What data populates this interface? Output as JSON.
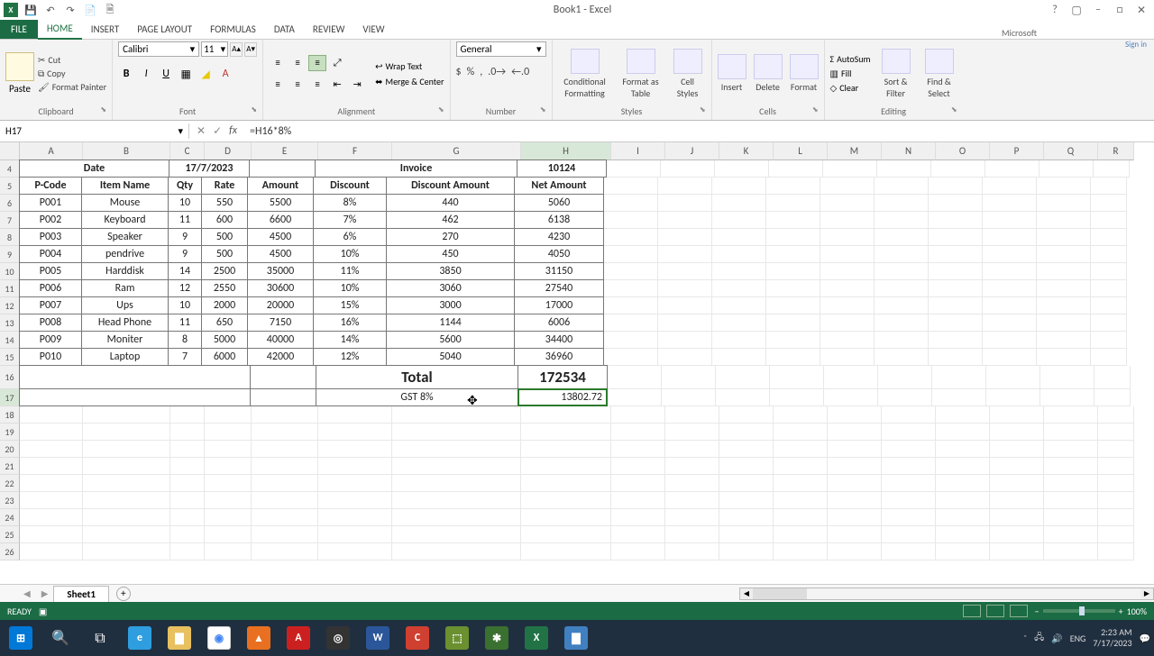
{
  "title": "Book1 - Excel",
  "brand": "Microsoft",
  "qat": {
    "save": "💾",
    "undo": "↶",
    "redo": "↷",
    "new": "📄",
    "doc": "🗎"
  },
  "tabs": [
    "FILE",
    "HOME",
    "INSERT",
    "PAGE LAYOUT",
    "FORMULAS",
    "DATA",
    "REVIEW",
    "VIEW"
  ],
  "ribbon": {
    "clipboard": {
      "name": "Clipboard",
      "paste": "Paste",
      "cut": "Cut",
      "copy": "Copy",
      "fpaint": "Format Painter"
    },
    "font": {
      "name": "Font",
      "family": "Calibri",
      "size": "11"
    },
    "align": {
      "name": "Alignment",
      "wrap": "Wrap Text",
      "merge": "Merge & Center"
    },
    "number": {
      "name": "Number",
      "fmt": "General"
    },
    "styles": {
      "name": "Styles",
      "cf": "Conditional Formatting",
      "fat": "Format as Table",
      "cs": "Cell Styles"
    },
    "cells": {
      "name": "Cells",
      "ins": "Insert",
      "del": "Delete",
      "fmt": "Format"
    },
    "editing": {
      "name": "Editing",
      "autosum": "AutoSum",
      "fill": "Fill",
      "clear": "Clear",
      "sort": "Sort & Filter",
      "find": "Find & Select"
    }
  },
  "signin": "Sign in",
  "namebox": "H17",
  "formula": "=H16*8%",
  "cols": [
    "A",
    "B",
    "C",
    "D",
    "E",
    "F",
    "G",
    "H",
    "I",
    "J",
    "K",
    "L",
    "M",
    "N",
    "O",
    "P",
    "Q",
    "R"
  ],
  "sheet": {
    "r4": {
      "date_lbl": "Date",
      "date_val": "17/7/2023",
      "invoice_lbl": "Invoice",
      "invoice_val": "10124"
    },
    "headers": [
      "P-Code",
      "Item Name",
      "Qty",
      "Rate",
      "Amount",
      "Discount",
      "Discount Amount",
      "Net Amount"
    ],
    "rows": [
      {
        "a": "P001",
        "b": "Mouse",
        "c": "10",
        "d": "550",
        "e": "5500",
        "f": "8%",
        "g": "440",
        "h": "5060"
      },
      {
        "a": "P002",
        "b": "Keyboard",
        "c": "11",
        "d": "600",
        "e": "6600",
        "f": "7%",
        "g": "462",
        "h": "6138"
      },
      {
        "a": "P003",
        "b": "Speaker",
        "c": "9",
        "d": "500",
        "e": "4500",
        "f": "6%",
        "g": "270",
        "h": "4230"
      },
      {
        "a": "P004",
        "b": "pendrive",
        "c": "9",
        "d": "500",
        "e": "4500",
        "f": "10%",
        "g": "450",
        "h": "4050"
      },
      {
        "a": "P005",
        "b": "Harddisk",
        "c": "14",
        "d": "2500",
        "e": "35000",
        "f": "11%",
        "g": "3850",
        "h": "31150"
      },
      {
        "a": "P006",
        "b": "Ram",
        "c": "12",
        "d": "2550",
        "e": "30600",
        "f": "10%",
        "g": "3060",
        "h": "27540"
      },
      {
        "a": "P007",
        "b": "Ups",
        "c": "10",
        "d": "2000",
        "e": "20000",
        "f": "15%",
        "g": "3000",
        "h": "17000"
      },
      {
        "a": "P008",
        "b": "Head Phone",
        "c": "11",
        "d": "650",
        "e": "7150",
        "f": "16%",
        "g": "1144",
        "h": "6006"
      },
      {
        "a": "P009",
        "b": "Moniter",
        "c": "8",
        "d": "5000",
        "e": "40000",
        "f": "14%",
        "g": "5600",
        "h": "34400"
      },
      {
        "a": "P010",
        "b": "Laptop",
        "c": "7",
        "d": "6000",
        "e": "42000",
        "f": "12%",
        "g": "5040",
        "h": "36960"
      }
    ],
    "total_lbl": "Total",
    "total_val": "172534",
    "gst_lbl": "GST 8%",
    "gst_val": "13802.72"
  },
  "sheettab": "Sheet1",
  "status": {
    "ready": "READY",
    "zoom": "100%"
  },
  "taskbar": {
    "time": "2:23 AM",
    "date": "7/17/2023"
  },
  "chart_data": {
    "type": "table",
    "title": "Invoice 10124 — 17/7/2023",
    "columns": [
      "P-Code",
      "Item Name",
      "Qty",
      "Rate",
      "Amount",
      "Discount",
      "Discount Amount",
      "Net Amount"
    ],
    "rows": [
      [
        "P001",
        "Mouse",
        10,
        550,
        5500,
        "8%",
        440,
        5060
      ],
      [
        "P002",
        "Keyboard",
        11,
        600,
        6600,
        "7%",
        462,
        6138
      ],
      [
        "P003",
        "Speaker",
        9,
        500,
        4500,
        "6%",
        270,
        4230
      ],
      [
        "P004",
        "pendrive",
        9,
        500,
        4500,
        "10%",
        450,
        4050
      ],
      [
        "P005",
        "Harddisk",
        14,
        2500,
        35000,
        "11%",
        3850,
        31150
      ],
      [
        "P006",
        "Ram",
        12,
        2550,
        30600,
        "10%",
        3060,
        27540
      ],
      [
        "P007",
        "Ups",
        10,
        2000,
        20000,
        "15%",
        3000,
        17000
      ],
      [
        "P008",
        "Head Phone",
        11,
        650,
        7150,
        "16%",
        1144,
        6006
      ],
      [
        "P009",
        "Moniter",
        8,
        5000,
        40000,
        "14%",
        5600,
        34400
      ],
      [
        "P010",
        "Laptop",
        7,
        6000,
        42000,
        "12%",
        5040,
        36960
      ]
    ],
    "totals": {
      "Total Net Amount": 172534,
      "GST 8%": 13802.72
    }
  }
}
